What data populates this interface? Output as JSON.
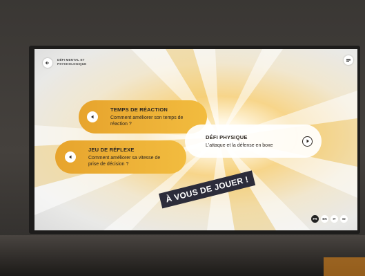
{
  "header": {
    "title": "DÉFI MENTAL ET PSYCHOLOGIQUE",
    "back_icon": "arrow-left-icon",
    "menu_icon": "menu-icon"
  },
  "cards": [
    {
      "title": "TEMPS DE RÉACTION",
      "subtitle": "Comment améliorer son temps de réaction ?",
      "color": "#f2b53a",
      "icon": "play-left-icon"
    },
    {
      "title": "JEU DE RÉFLEXE",
      "subtitle": "Comment améliorer sa vitesse de prise de décision ?",
      "color": "#f2b53a",
      "icon": "play-left-icon"
    },
    {
      "title": "DÉFI PHYSIQUE",
      "subtitle": "L'attaque et la défense en boxe",
      "color": "#ffffff",
      "icon": "play-right-icon"
    }
  ],
  "banner": {
    "text": "À VOUS DE JOUER !"
  },
  "languages": [
    {
      "code": "FR",
      "active": true
    },
    {
      "code": "EN",
      "active": false
    },
    {
      "code": "IT",
      "active": false
    },
    {
      "code": "ID",
      "active": false
    }
  ]
}
